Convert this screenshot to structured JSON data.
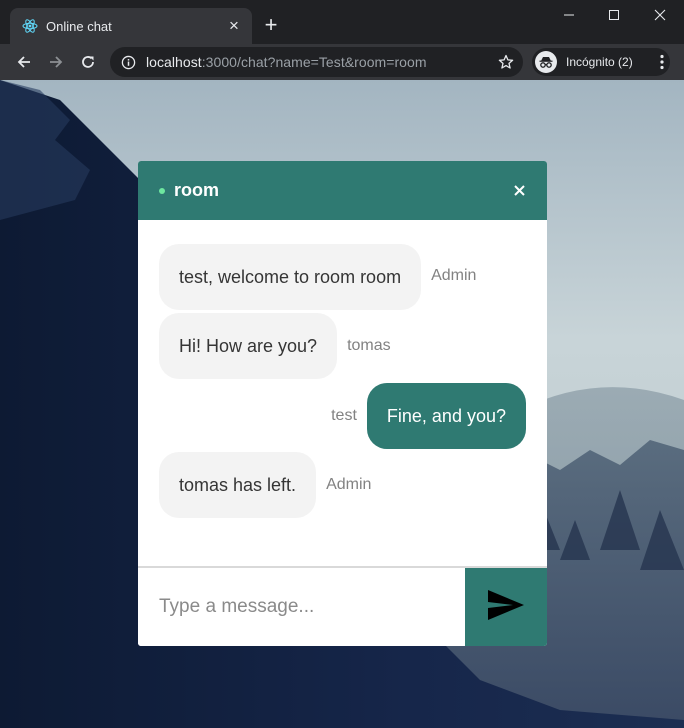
{
  "browser": {
    "tab": {
      "title": "Online chat",
      "favicon": "react-icon"
    },
    "address": {
      "host": "localhost",
      "rest": ":3000/chat?name=Test&room=room"
    },
    "incognito_label": "Incógnito (2)"
  },
  "chat": {
    "room_name": "room",
    "status_color": "#6ee7a0",
    "accent_color": "#2f7a72",
    "messages": [
      {
        "text": "test, welcome to room room",
        "sender": "Admin",
        "own": false
      },
      {
        "text": "Hi! How are you?",
        "sender": "tomas",
        "own": false
      },
      {
        "text": "Fine, and you?",
        "sender": "test",
        "own": true
      },
      {
        "text": "tomas has left.",
        "sender": "Admin",
        "own": false
      }
    ],
    "input": {
      "placeholder": "Type a message...",
      "value": ""
    }
  }
}
